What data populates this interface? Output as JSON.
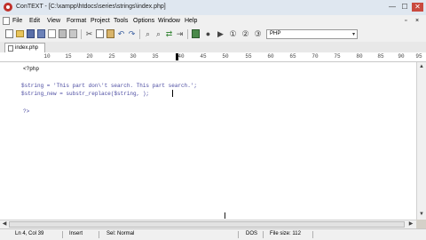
{
  "window": {
    "title": "ConTEXT - [C:\\xampp\\htdocs\\series\\strings\\index.php]",
    "minimize": "—",
    "maximize": "☐",
    "close": "✕"
  },
  "menu": {
    "items": [
      "File",
      "Edit",
      "View",
      "Format",
      "Project",
      "Tools",
      "Options",
      "Window",
      "Help"
    ],
    "restore": "▫",
    "close": "×"
  },
  "toolbar": {
    "highlighter": "PHP",
    "highlighter_arrow": "▾"
  },
  "tabs": [
    {
      "label": "index.php"
    }
  ],
  "ruler": {
    "ticks": [
      "10",
      "15",
      "20",
      "25",
      "30",
      "35",
      "40",
      "45",
      "50",
      "55",
      "60",
      "65",
      "70",
      "75",
      "80",
      "85",
      "90",
      "95"
    ]
  },
  "editor": {
    "lines": [
      "<?php",
      "",
      "$string = 'This part don\\'t search. This part search.';",
      "$string_new = substr_replace($string, );",
      "",
      "?>"
    ]
  },
  "colors": {
    "code": "#4a4aa0",
    "title_bar": "#dfe7f0",
    "chrome": "#f0f0f0"
  },
  "status": {
    "position": "Ln 4, Col 39",
    "mode": "Insert",
    "selection": "Sel: Normal",
    "format": "DOS",
    "filesize": "File size: 112"
  }
}
